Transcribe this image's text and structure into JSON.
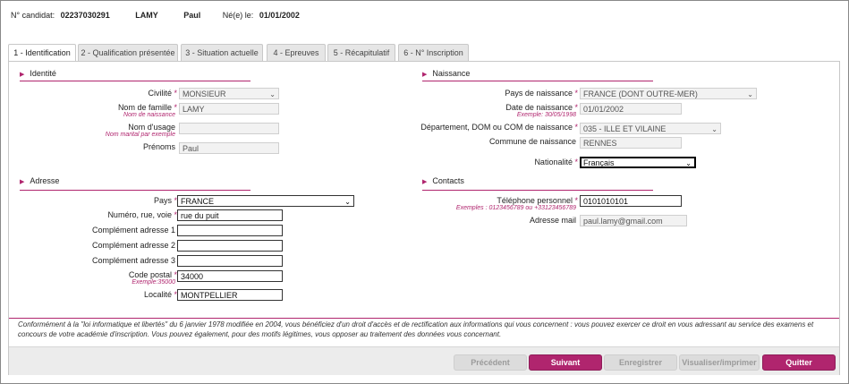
{
  "header": {
    "candidate_label": "N° candidat:",
    "candidate_number": "02237030291",
    "last_name": "LAMY",
    "first_name": "Paul",
    "born_label": "Né(e) le:",
    "birth_date": "01/01/2002"
  },
  "tabs": [
    {
      "label": "1 - Identification"
    },
    {
      "label": "2 - Qualification présentée"
    },
    {
      "label": "3 - Situation actuelle"
    },
    {
      "label": "4 - Epreuves"
    },
    {
      "label": "5 - Récapitulatif"
    },
    {
      "label": "6 - N° Inscription"
    }
  ],
  "identite": {
    "title": "Identité",
    "civilite": {
      "label": "Civilité",
      "value": "MONSIEUR"
    },
    "nom_famille": {
      "label": "Nom de famille",
      "hint": "Nom de naissance",
      "value": "LAMY"
    },
    "nom_usage": {
      "label": "Nom d'usage",
      "hint": "Nom marital par exemple",
      "value": ""
    },
    "prenoms": {
      "label": "Prénoms",
      "value": "Paul"
    }
  },
  "naissance": {
    "title": "Naissance",
    "pays": {
      "label": "Pays de naissance",
      "value": "FRANCE (DONT OUTRE-MER)"
    },
    "date": {
      "label": "Date de naissance",
      "hint": "Exemple: 30/05/1998",
      "value": "01/01/2002"
    },
    "departement": {
      "label": "Département, DOM ou COM de naissance",
      "value": "035 - ILLE ET VILAINE"
    },
    "commune": {
      "label": "Commune de naissance",
      "value": "RENNES"
    },
    "nationalite": {
      "label": "Nationalité",
      "value": "Français"
    }
  },
  "adresse": {
    "title": "Adresse",
    "pays": {
      "label": "Pays",
      "value": "FRANCE"
    },
    "numero_rue": {
      "label": "Numéro, rue, voie",
      "value": "rue du puit"
    },
    "complement1": {
      "label": "Complément adresse 1",
      "value": ""
    },
    "complement2": {
      "label": "Complément adresse 2",
      "value": ""
    },
    "complement3": {
      "label": "Complément adresse 3",
      "value": ""
    },
    "code_postal": {
      "label": "Code postal",
      "hint": "Exemple:35000",
      "value": "34000"
    },
    "localite": {
      "label": "Localité",
      "value": "MONTPELLIER"
    }
  },
  "contacts": {
    "title": "Contacts",
    "telephone": {
      "label": "Téléphone personnel",
      "hint": "Exemples : 0123456789 ou +33123456789",
      "value": "0101010101"
    },
    "email": {
      "label": "Adresse mail",
      "value": "paul.lamy@gmail.com"
    }
  },
  "required_mark": "*",
  "legal_text": "Conformément à la \"loi informatique et libertés\" du 6 janvier 1978 modifiée en 2004, vous bénéficiez d'un droit d'accès et de rectification aux informations qui vous concernent : vous pouvez exercer ce droit en vous adressant au service des examens et concours de votre académie d'inscription. Vous pouvez également, pour des motifs légitimes, vous opposer au traitement des données vous concernant.",
  "buttons": {
    "precedent": "Précédent",
    "suivant": "Suivant",
    "enregistrer": "Enregistrer",
    "visualiser": "Visualiser/imprimer",
    "quitter": "Quitter"
  },
  "colors": {
    "accent": "#b0256e"
  }
}
